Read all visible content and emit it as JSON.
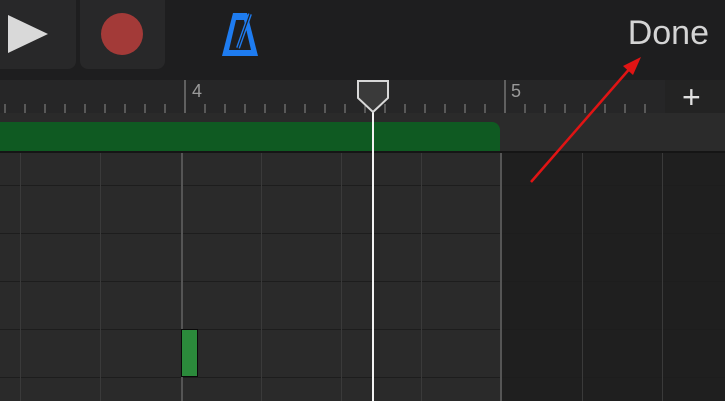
{
  "toolbar": {
    "done_label": "Done"
  },
  "ruler": {
    "bars": [
      "4",
      "5"
    ]
  },
  "colors": {
    "region": "#0f5a22",
    "note": "#2b8a3b",
    "record": "#a33a38",
    "metronome": "#1e7cf0",
    "annotation": "#e01414"
  },
  "icons": [
    "play-icon",
    "record-icon",
    "metronome-icon",
    "plus-icon",
    "playhead-icon"
  ]
}
